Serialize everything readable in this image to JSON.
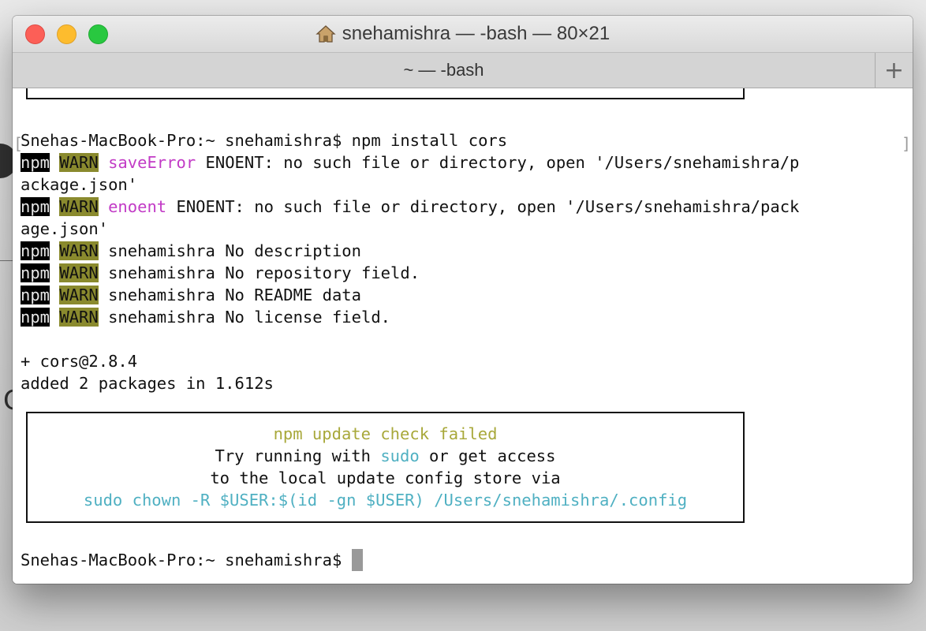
{
  "window": {
    "title": "snehamishra — -bash — 80×21",
    "tab_label": "~ — -bash",
    "new_tab_symbol": "+"
  },
  "terminal": {
    "prompt_line": "Snehas-MacBook-Pro:~ snehamishra$ npm install cors",
    "warn_lines": [
      {
        "npm": "npm",
        "warn": "WARN",
        "code": "saveError",
        "text": " ENOENT: no such file or directory, open '/Users/snehamishra/p"
      },
      {
        "npm": "npm",
        "warn": "WARN",
        "code": "enoent",
        "text": " ENOENT: no such file or directory, open '/Users/snehamishra/pack"
      },
      {
        "npm": "npm",
        "warn": "WARN",
        "code": "",
        "text": " snehamishra No description"
      },
      {
        "npm": "npm",
        "warn": "WARN",
        "code": "",
        "text": " snehamishra No repository field."
      },
      {
        "npm": "npm",
        "warn": "WARN",
        "code": "",
        "text": " snehamishra No README data"
      },
      {
        "npm": "npm",
        "warn": "WARN",
        "code": "",
        "text": " snehamishra No license field."
      }
    ],
    "wrap_1": "ackage.json'",
    "wrap_2": "age.json'",
    "result_1": "+ cors@2.8.4",
    "result_2": "added 2 packages in 1.612s",
    "box": {
      "title": "npm update check failed",
      "line2_a": "Try running with ",
      "line2_b": "sudo",
      "line2_c": " or get access",
      "line3": "to the local update config store via",
      "line4": "sudo chown -R $USER:$(id -gn $USER) /Users/snehamishra/.config"
    },
    "final_prompt": "Snehas-MacBook-Pro:~ snehamishra$ "
  },
  "colors": {
    "warn_bg": "#8a8a2e",
    "error_code": "#c23bc6",
    "box_title": "#a8a83a",
    "box_cmd": "#4fb0c2"
  },
  "icons": {
    "home": "home-icon",
    "close": "close-button",
    "minimize": "minimize-button",
    "zoom": "zoom-button"
  }
}
